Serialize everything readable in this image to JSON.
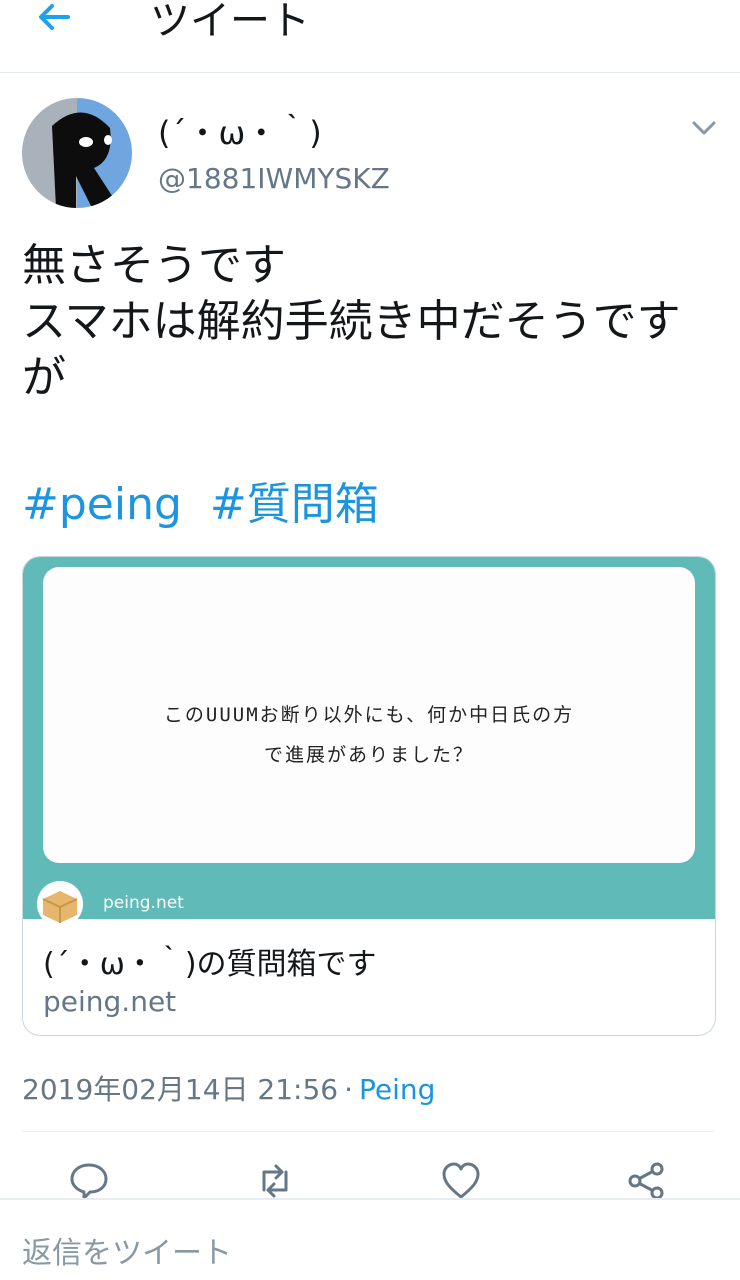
{
  "header": {
    "title": "ツイート",
    "back_icon": "back-arrow-icon"
  },
  "tweet": {
    "display_name": "(´・ω・｀)",
    "handle": "@1881IWMYSKZ",
    "text_lines": [
      "無さそうです",
      "スマホは解約手続き中だそうです",
      "が"
    ],
    "hashtags": [
      "#peing",
      "#質問箱"
    ],
    "timestamp": "2019年02月14日 21:56",
    "separator": "·",
    "source": "Peing"
  },
  "card": {
    "question_lines": [
      "このUUUMお断り以外にも、何か中日氏の方",
      "で進展がありました？"
    ],
    "image_domain": "peing.net",
    "title": "(´・ω・｀)の質問箱です",
    "domain": "peing.net"
  },
  "actions": [
    "reply-icon",
    "retweet-icon",
    "like-icon",
    "share-icon"
  ],
  "reply_bar": {
    "placeholder": "返信をツイート"
  },
  "colors": {
    "link": "#1b95e0",
    "secondary": "#657786",
    "card_teal": "#5fbab8",
    "border": "#e6ecf0"
  }
}
